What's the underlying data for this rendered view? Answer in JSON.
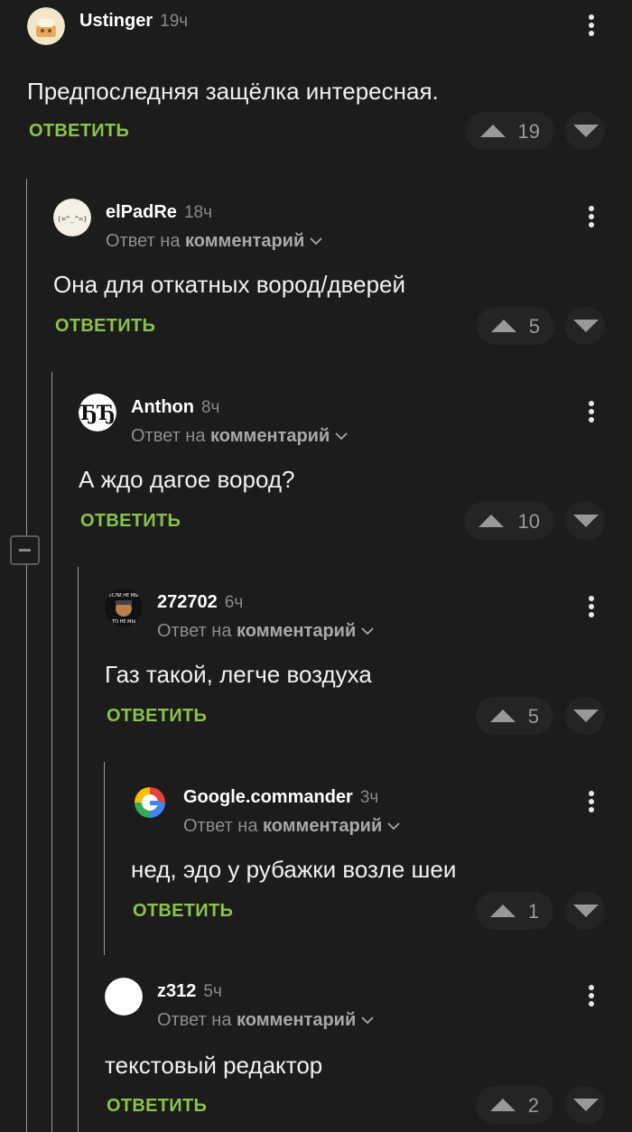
{
  "comments": [
    {
      "author": "Ustinger",
      "time": "19ч",
      "text": "Предпоследняя защёлка интересная.",
      "reply_label": "ОТВЕТИТЬ",
      "score": "19"
    },
    {
      "author": "elPadRe",
      "time": "18ч",
      "reply_prefix": "Ответ на",
      "reply_target": "комментарий",
      "text": "Она для откатных вород/дверей",
      "reply_label": "ОТВЕТИТЬ",
      "score": "5",
      "avatar_text": "(=^_^=)"
    },
    {
      "author": "Anthon",
      "time": "8ч",
      "reply_prefix": "Ответ на",
      "reply_target": "комментарий",
      "text": "А ждо дагое вород?",
      "reply_label": "ОТВЕТИТЬ",
      "score": "10",
      "avatar_text": "ЂЂ"
    },
    {
      "author": "272702",
      "time": "6ч",
      "reply_prefix": "Ответ на",
      "reply_target": "комментарий",
      "text": "Газ такой, легче воздуха",
      "reply_label": "ОТВЕТИТЬ",
      "score": "5",
      "avatar_text_top": "ЕСЛИ НЕ МЫ",
      "avatar_text_bottom": "ТО НЕ МЫ"
    },
    {
      "author": "Google.commander",
      "time": "3ч",
      "reply_prefix": "Ответ на",
      "reply_target": "комментарий",
      "text": "нед, эдо у рубажки возле шеи",
      "reply_label": "ОТВЕТИТЬ",
      "score": "1"
    },
    {
      "author": "z312",
      "time": "5ч",
      "reply_prefix": "Ответ на",
      "reply_target": "комментарий",
      "text": "текстовый редактор",
      "reply_label": "ОТВЕТИТЬ",
      "score": "2"
    }
  ],
  "colors": {
    "background": "#1c1c1c",
    "reply_link": "#8bc34a",
    "vote_pill": "#242424",
    "thread_line": "#9a9a9a"
  },
  "icons": [
    "kebab-menu-icon",
    "chevron-down-icon",
    "upvote-arrow-icon",
    "downvote-arrow-icon",
    "collapse-minus-icon"
  ]
}
